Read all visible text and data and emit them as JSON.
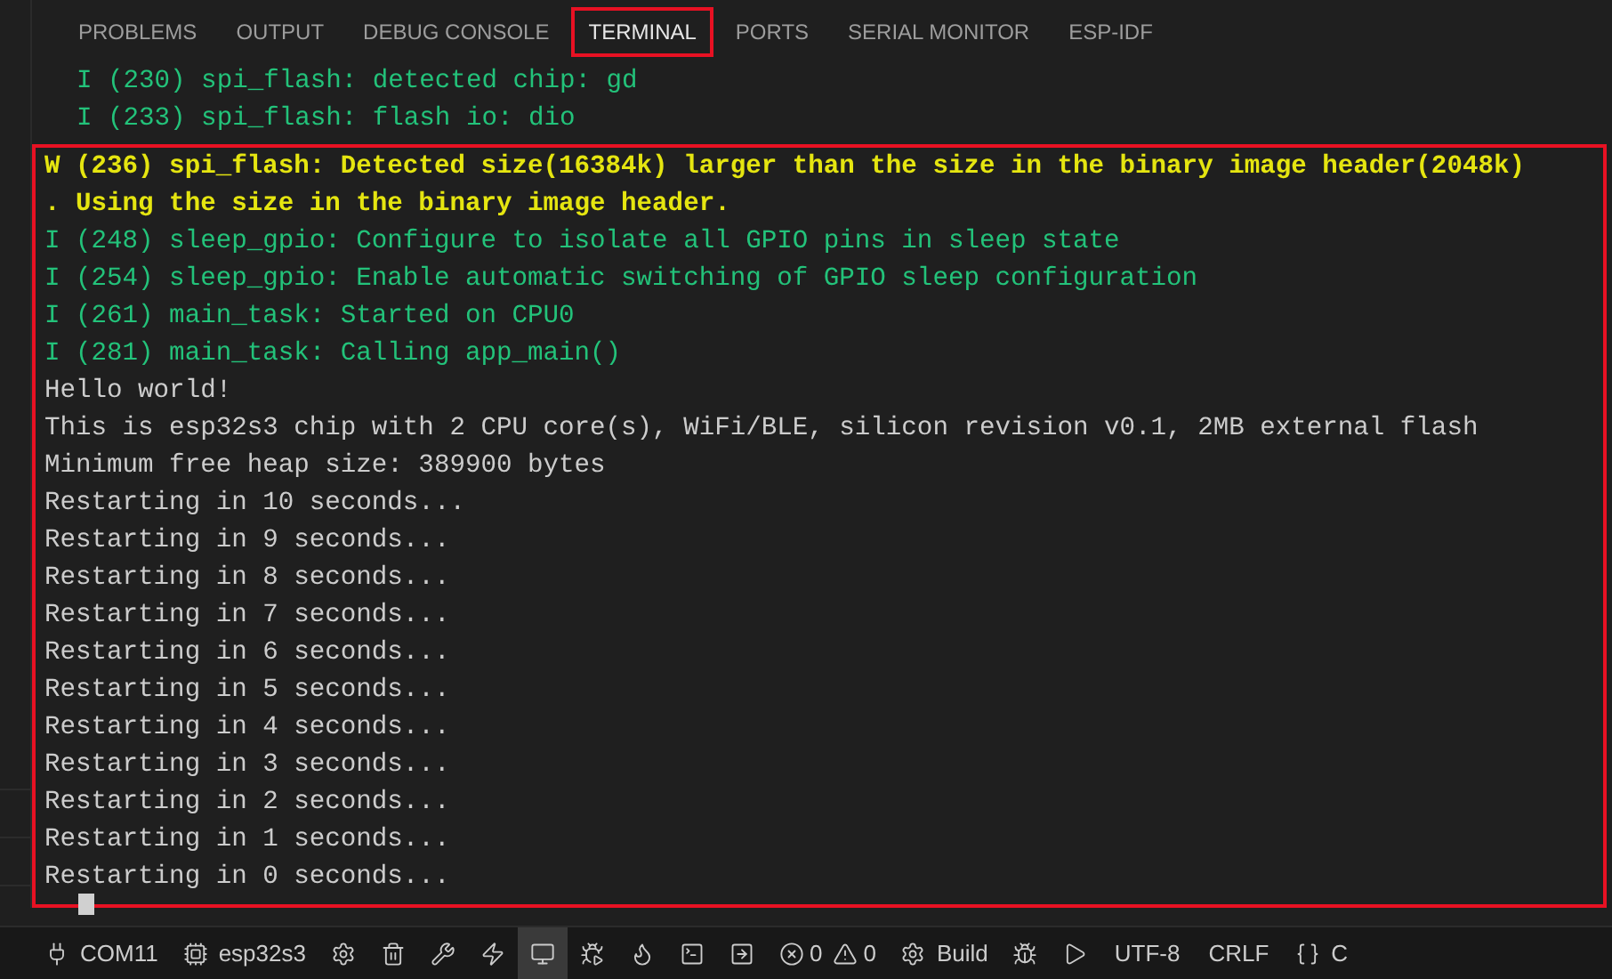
{
  "tabs": [
    {
      "label": "PROBLEMS",
      "selected": false,
      "highlighted": false
    },
    {
      "label": "OUTPUT",
      "selected": false,
      "highlighted": false
    },
    {
      "label": "DEBUG CONSOLE",
      "selected": false,
      "highlighted": false
    },
    {
      "label": "TERMINAL",
      "selected": true,
      "highlighted": true
    },
    {
      "label": "PORTS",
      "selected": false,
      "highlighted": false
    },
    {
      "label": "SERIAL MONITOR",
      "selected": false,
      "highlighted": false
    },
    {
      "label": "ESP-IDF",
      "selected": false,
      "highlighted": false
    }
  ],
  "terminal": {
    "lines_before": [
      {
        "kind": "info",
        "text": "I (230) spi_flash: detected chip: gd"
      },
      {
        "kind": "info",
        "text": "I (233) spi_flash: flash io: dio"
      }
    ],
    "highlighted_lines": [
      {
        "kind": "warn",
        "text": "W (236) spi_flash: Detected size(16384k) larger than the size in the binary image header(2048k)"
      },
      {
        "kind": "warn",
        "text": ". Using the size in the binary image header."
      },
      {
        "kind": "info",
        "text": "I (248) sleep_gpio: Configure to isolate all GPIO pins in sleep state"
      },
      {
        "kind": "info",
        "text": "I (254) sleep_gpio: Enable automatic switching of GPIO sleep configuration"
      },
      {
        "kind": "info",
        "text": "I (261) main_task: Started on CPU0"
      },
      {
        "kind": "info",
        "text": "I (281) main_task: Calling app_main()"
      },
      {
        "kind": "plain",
        "text": "Hello world!"
      },
      {
        "kind": "plain",
        "text": "This is esp32s3 chip with 2 CPU core(s), WiFi/BLE, silicon revision v0.1, 2MB external flash"
      },
      {
        "kind": "plain",
        "text": "Minimum free heap size: 389900 bytes"
      },
      {
        "kind": "plain",
        "text": "Restarting in 10 seconds..."
      },
      {
        "kind": "plain",
        "text": "Restarting in 9 seconds..."
      },
      {
        "kind": "plain",
        "text": "Restarting in 8 seconds..."
      },
      {
        "kind": "plain",
        "text": "Restarting in 7 seconds..."
      },
      {
        "kind": "plain",
        "text": "Restarting in 6 seconds..."
      },
      {
        "kind": "plain",
        "text": "Restarting in 5 seconds..."
      },
      {
        "kind": "plain",
        "text": "Restarting in 4 seconds..."
      },
      {
        "kind": "plain",
        "text": "Restarting in 3 seconds..."
      },
      {
        "kind": "plain",
        "text": "Restarting in 2 seconds..."
      },
      {
        "kind": "plain",
        "text": "Restarting in 1 seconds..."
      },
      {
        "kind": "plain",
        "text": "Restarting in 0 seconds..."
      }
    ]
  },
  "status_bar": {
    "items": [
      {
        "kind": "labeled",
        "label": "COM11"
      },
      {
        "kind": "labeled",
        "label": "esp32s3"
      },
      {
        "kind": "icon",
        "selected": false
      },
      {
        "kind": "icon",
        "selected": false
      },
      {
        "kind": "icon",
        "selected": false
      },
      {
        "kind": "icon",
        "selected": false
      },
      {
        "kind": "icon",
        "selected": true
      },
      {
        "kind": "icon",
        "selected": false
      },
      {
        "kind": "icon",
        "selected": false
      },
      {
        "kind": "icon",
        "selected": false
      },
      {
        "kind": "icon",
        "selected": false
      },
      {
        "kind": "problems",
        "errors": "0",
        "warnings": "0"
      },
      {
        "kind": "labeled",
        "label": "Build"
      },
      {
        "kind": "icon",
        "selected": false
      },
      {
        "kind": "icon",
        "selected": false
      },
      {
        "kind": "text",
        "label": "UTF-8"
      },
      {
        "kind": "text",
        "label": "CRLF"
      },
      {
        "kind": "labeled",
        "label": "C"
      }
    ]
  }
}
